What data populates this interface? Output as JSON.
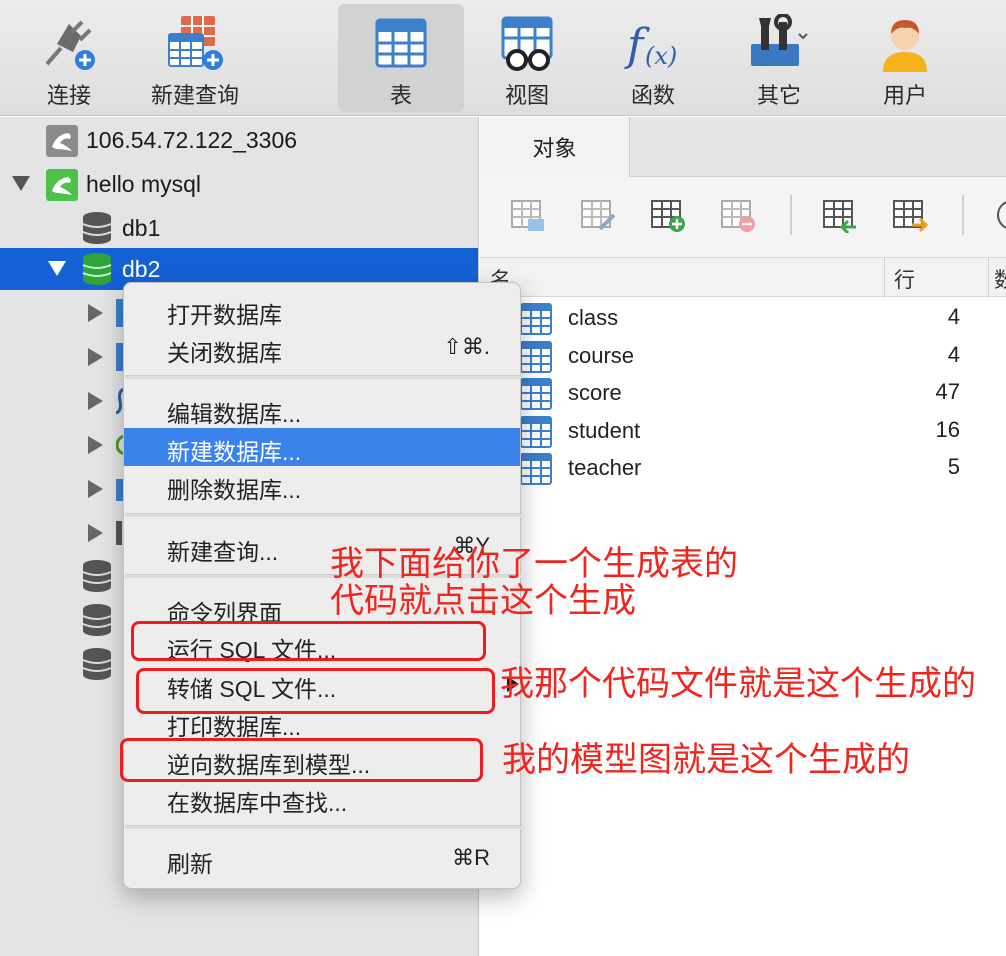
{
  "toolbar": {
    "items": [
      {
        "label": "连接",
        "icon": "plug-icon"
      },
      {
        "label": "新建查询",
        "icon": "new-query-icon"
      },
      {
        "label": "表",
        "icon": "table-icon"
      },
      {
        "label": "视图",
        "icon": "view-icon"
      },
      {
        "label": "函数",
        "icon": "function-icon"
      },
      {
        "label": "其它",
        "icon": "tools-icon"
      },
      {
        "label": "用户",
        "icon": "user-icon"
      }
    ],
    "active": "表"
  },
  "sidebar": {
    "connections": [
      {
        "label": "106.54.72.122_3306",
        "status": "disconnected"
      },
      {
        "label": "hello mysql",
        "status": "connected"
      }
    ],
    "databases": [
      {
        "label": "db1"
      },
      {
        "label": "db2",
        "selected": true
      }
    ]
  },
  "right_pane": {
    "tab": "对象",
    "columns": [
      "名",
      "行",
      "数"
    ],
    "rows": [
      {
        "name": "class",
        "rows": "4"
      },
      {
        "name": "course",
        "rows": "4"
      },
      {
        "name": "score",
        "rows": "47"
      },
      {
        "name": "student",
        "rows": "16"
      },
      {
        "name": "teacher",
        "rows": "5"
      }
    ]
  },
  "context_menu": {
    "items": [
      {
        "label": "打开数据库",
        "shortcut": ""
      },
      {
        "label": "关闭数据库",
        "shortcut": "⇧⌘."
      },
      {
        "label": "编辑数据库...",
        "shortcut": ""
      },
      {
        "label": "新建数据库...",
        "shortcut": ""
      },
      {
        "label": "删除数据库...",
        "shortcut": ""
      },
      {
        "label": "新建查询...",
        "shortcut": "⌘Y"
      },
      {
        "label": "命令列界面",
        "shortcut": ""
      },
      {
        "label": "运行 SQL 文件...",
        "shortcut": ""
      },
      {
        "label": "转储 SQL 文件...",
        "shortcut": ""
      },
      {
        "label": "打印数据库...",
        "shortcut": ""
      },
      {
        "label": "逆向数据库到模型...",
        "shortcut": ""
      },
      {
        "label": "在数据库中查找...",
        "shortcut": ""
      },
      {
        "label": "刷新",
        "shortcut": "⌘R"
      }
    ],
    "highlighted": "新建数据库..."
  },
  "annotations": {
    "note1_line1": "我下面给你了一个生成表的",
    "note1_line2": "代码就点击这个生成",
    "note2": "我那个代码文件就是这个生成的",
    "note3": "我的模型图就是这个生成的",
    "color": "#f0261e"
  },
  "colors": {
    "selection": "#1461d6",
    "menu_highlight": "#3b82ec",
    "annotation_red": "#ee1d1d"
  }
}
